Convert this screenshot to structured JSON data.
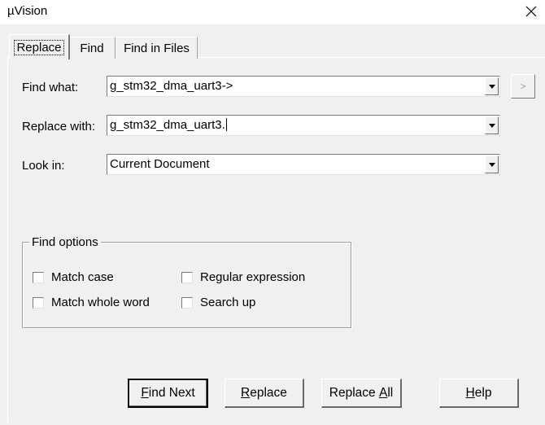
{
  "window": {
    "title": "µVision"
  },
  "tabs": [
    {
      "label": "Replace",
      "active": true
    },
    {
      "label": "Find",
      "active": false
    },
    {
      "label": "Find in Files",
      "active": false
    }
  ],
  "fields": {
    "find_what_label": "Find what:",
    "find_what_value": "g_stm32_dma_uart3->",
    "replace_with_label": "Replace with:",
    "replace_with_value": "g_stm32_dma_uart3.",
    "look_in_label": "Look in:",
    "look_in_value": "Current Document",
    "expand_button": ">"
  },
  "find_options": {
    "legend": "Find options",
    "match_case": "Match case",
    "regular_expression": "Regular expression",
    "match_whole_word": "Match whole word",
    "search_up": "Search up"
  },
  "buttons": {
    "find_next": {
      "mnemonic": "F",
      "rest": "ind Next"
    },
    "replace": {
      "mnemonic": "R",
      "rest": "eplace"
    },
    "replace_all": {
      "before": "Replace ",
      "mnemonic": "A",
      "rest": "ll"
    },
    "help": {
      "mnemonic": "H",
      "rest": "elp"
    }
  }
}
